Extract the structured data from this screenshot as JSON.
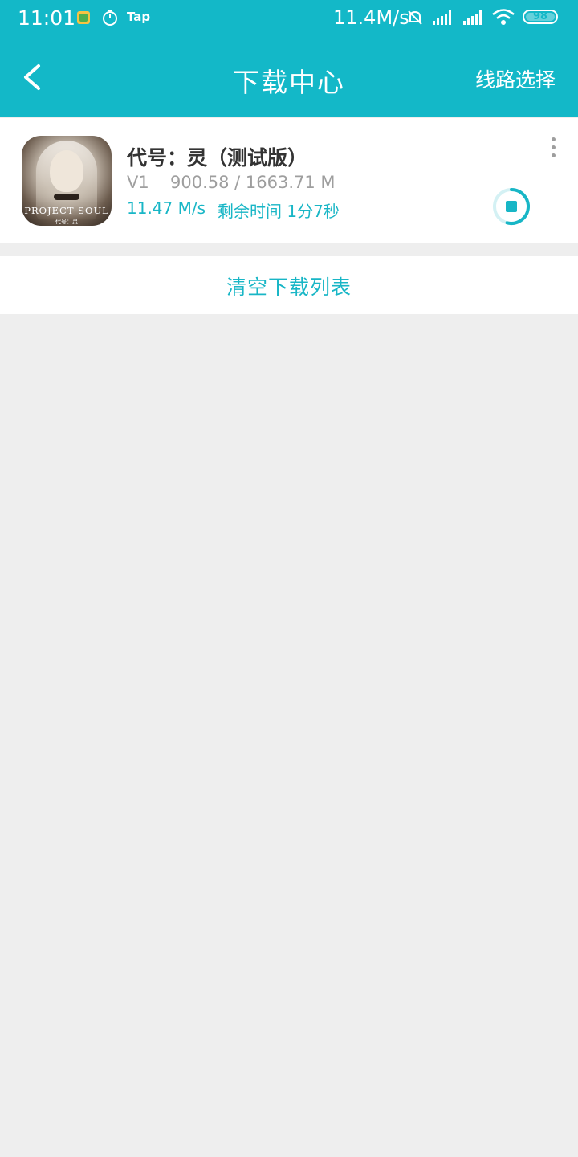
{
  "status_bar": {
    "time": "11:01",
    "network_speed": "11.4M/s",
    "battery": "98",
    "icons": [
      "notes-app-icon",
      "stopwatch-icon",
      "tap-app-icon",
      "bell-muted-icon",
      "signal-icon",
      "signal-icon",
      "wifi-icon",
      "battery-icon"
    ],
    "tap_label": "Tap"
  },
  "header": {
    "title": "下载中心",
    "route_select": "线路选择",
    "accent_color": "#13b8c8"
  },
  "downloads": [
    {
      "name": "代号：灵（测试版）",
      "icon_text": "PROJECT SOUL",
      "icon_subtext": "代号：灵",
      "version": "V1",
      "size_progress": "900.58 / 1663.71 M",
      "progress_fraction": 0.5413,
      "speed": "11.47 M/s",
      "remaining": "剩余时间 1分7秒"
    }
  ],
  "actions": {
    "clear_list": "清空下载列表"
  }
}
